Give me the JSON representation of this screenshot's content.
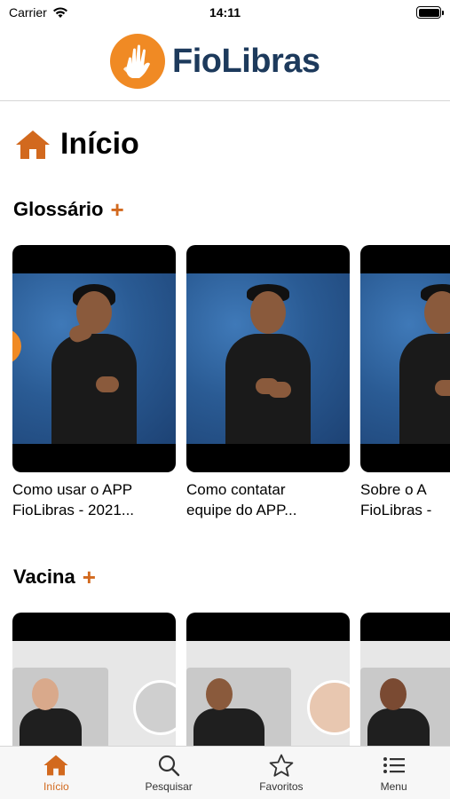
{
  "status_bar": {
    "carrier": "Carrier",
    "time": "14:11"
  },
  "header": {
    "logo_text": "FioLibras"
  },
  "page": {
    "title": "Início"
  },
  "sections": [
    {
      "title": "Glossário",
      "plus": "+",
      "cards": [
        {
          "title": "Como usar o APP\nFioLibras - 2021..."
        },
        {
          "title": "Como contatar\nequipe do APP..."
        },
        {
          "title": "Sobre o A\nFioLibras -"
        }
      ]
    },
    {
      "title": "Vacina",
      "plus": "+"
    }
  ],
  "tabbar": {
    "items": [
      {
        "label": "Início",
        "icon": "home-icon",
        "active": true
      },
      {
        "label": "Pesquisar",
        "icon": "search-icon",
        "active": false
      },
      {
        "label": "Favoritos",
        "icon": "star-icon",
        "active": false
      },
      {
        "label": "Menu",
        "icon": "list-icon",
        "active": false
      }
    ]
  },
  "colors": {
    "accent": "#d2691e",
    "logo_orange": "#f08a24",
    "logo_text": "#1d3a5c"
  }
}
